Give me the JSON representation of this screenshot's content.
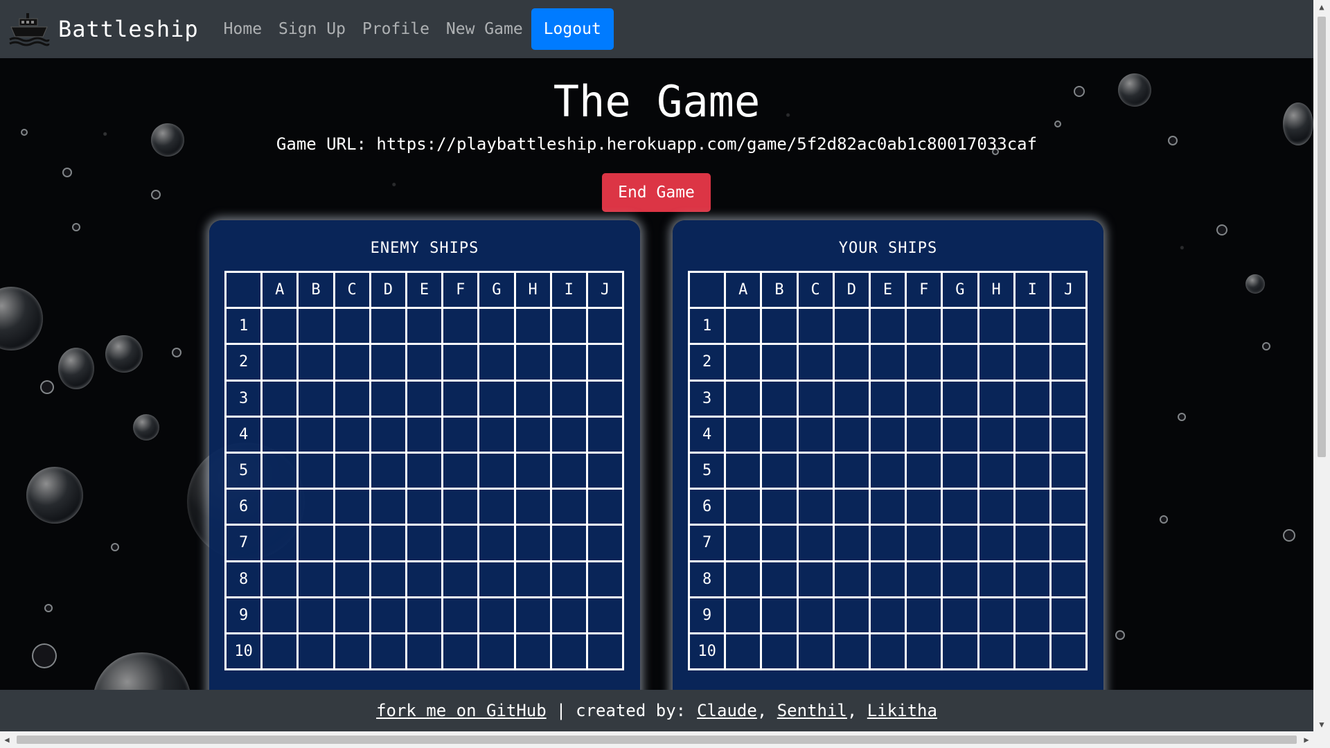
{
  "nav": {
    "brand": "Battleship",
    "brand_icon": "ship-icon",
    "links": [
      "Home",
      "Sign Up",
      "Profile",
      "New Game"
    ],
    "logout": "Logout"
  },
  "main": {
    "title": "The Game",
    "game_url": "Game URL: https://playbattleship.herokuapp.com/game/5f2d82ac0ab1c80017033caf",
    "end_game": "End Game"
  },
  "boards": {
    "enemy_title": "ENEMY SHIPS",
    "your_title": "YOUR SHIPS",
    "columns": [
      "A",
      "B",
      "C",
      "D",
      "E",
      "F",
      "G",
      "H",
      "I",
      "J"
    ],
    "rows": [
      "1",
      "2",
      "3",
      "4",
      "5",
      "6",
      "7",
      "8",
      "9",
      "10"
    ]
  },
  "footer": {
    "github": "fork me on GitHub",
    "separator": "|",
    "created_by": "created by:",
    "authors": [
      "Claude",
      "Senthil",
      "Likitha"
    ]
  },
  "colors": {
    "navbar": "#343a40",
    "logout_button": "#007bff",
    "end_game_button": "#dc3545",
    "board_panel": "#0a285f"
  }
}
